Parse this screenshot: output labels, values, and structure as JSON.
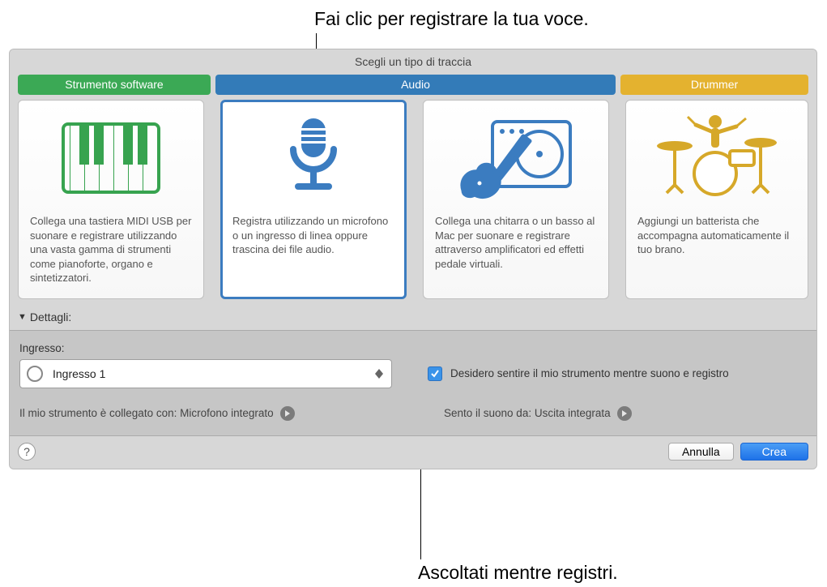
{
  "callouts": {
    "top": "Fai clic per registrare la tua voce.",
    "bottom": "Ascoltati mentre registri."
  },
  "header": {
    "title": "Scegli un tipo di traccia"
  },
  "tabs": {
    "software": "Strumento software",
    "audio": "Audio",
    "drummer": "Drummer"
  },
  "cards": {
    "keyboard": "Collega una tastiera MIDI USB per suonare e registrare utilizzando una vasta gamma di strumenti come pianoforte, organo e sintetizzatori.",
    "mic": "Registra utilizzando un microfono o un ingresso di linea oppure trascina dei file audio.",
    "guitar": "Collega una chitarra o un basso al Mac per suonare e registrare attraverso amplificatori ed effetti pedale virtuali.",
    "drums": "Aggiungi un batterista che accompagna automaticamente il tuo brano."
  },
  "details": {
    "header": "Dettagli:",
    "input_label": "Ingresso:",
    "input_value": "Ingresso 1",
    "monitor_label": "Desidero sentire il mio strumento mentre suono e registro",
    "connected_label": "Il mio strumento è collegato con: Microfono integrato",
    "hear_label": "Sento il suono da: Uscita integrata"
  },
  "footer": {
    "cancel": "Annulla",
    "create": "Crea"
  }
}
